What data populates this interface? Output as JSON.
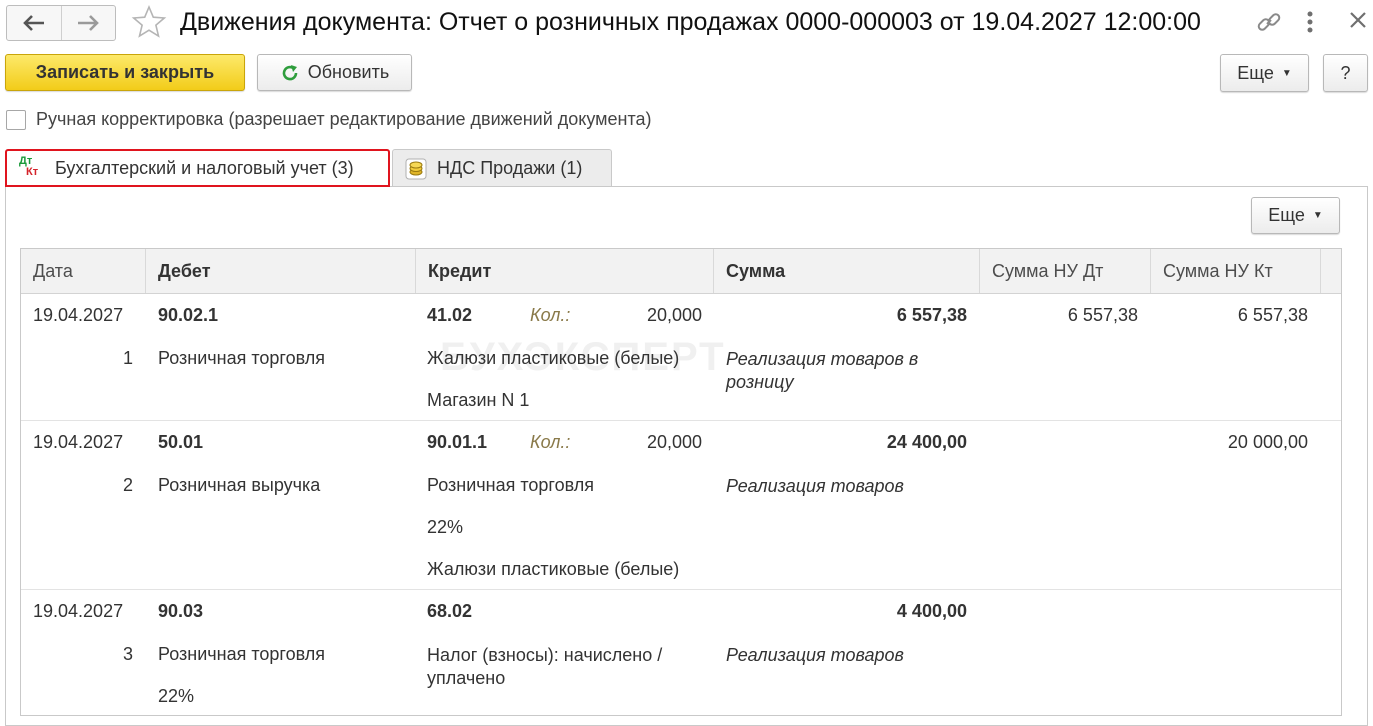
{
  "window": {
    "title": "Движения документа: Отчет о розничных продажах 0000-000003 от 19.04.2027 12:00:00"
  },
  "toolbar": {
    "save_close_label": "Записать и закрыть",
    "refresh_label": "Обновить",
    "more_label": "Еще",
    "help_label": "?"
  },
  "manual_edit": {
    "label": "Ручная корректировка (разрешает редактирование движений документа)",
    "checked": false
  },
  "tabs": [
    {
      "icon_top": "Дт",
      "icon_bottom": "Кт",
      "label": "Бухгалтерский и налоговый учет (3)",
      "active": true
    },
    {
      "label": "НДС Продажи (1)",
      "active": false
    }
  ],
  "panel": {
    "more_label": "Еще"
  },
  "watermark": "БУХЭКСПЕРТ",
  "table": {
    "columns": [
      "Дата",
      "Дебет",
      "Кредит",
      "Сумма",
      "Сумма НУ Дт",
      "Сумма НУ Кт"
    ],
    "qty_label": "Кол.:",
    "rows": [
      {
        "date": "19.04.2027",
        "num": "1",
        "debit_account": "90.02.1",
        "debit_sub": [
          "Розничная торговля"
        ],
        "credit_account": "41.02",
        "qty": "20,000",
        "credit_sub": [
          "Жалюзи пластиковые (белые)",
          "Магазин N 1"
        ],
        "sum": "6 557,38",
        "sum_comment": "Реализация товаров в розницу",
        "nu_dt": "6 557,38",
        "nu_kt": "6 557,38"
      },
      {
        "date": "19.04.2027",
        "num": "2",
        "debit_account": "50.01",
        "debit_sub": [
          "Розничная выручка"
        ],
        "credit_account": "90.01.1",
        "qty": "20,000",
        "credit_sub": [
          "Розничная торговля",
          "22%",
          "Жалюзи пластиковые (белые)"
        ],
        "sum": "24 400,00",
        "sum_comment": "Реализация товаров",
        "nu_dt": "",
        "nu_kt": "20 000,00"
      },
      {
        "date": "19.04.2027",
        "num": "3",
        "debit_account": "90.03",
        "debit_sub": [
          "Розничная торговля",
          "22%"
        ],
        "credit_account": "68.02",
        "qty": "",
        "credit_sub": [
          "Налог (взносы): начислено / уплачено"
        ],
        "sum": "4 400,00",
        "sum_comment": "Реализация товаров",
        "nu_dt": "",
        "nu_kt": ""
      }
    ]
  }
}
